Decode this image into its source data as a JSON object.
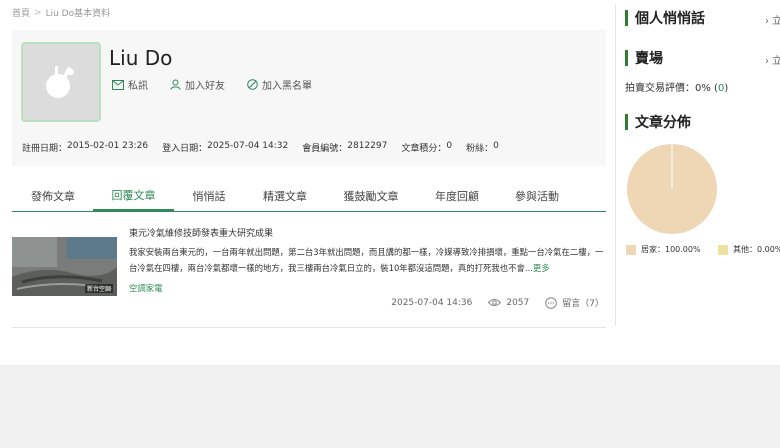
{
  "breadcrumb": {
    "home": "首頁",
    "sep": ">",
    "current": "Liu Do基本資料"
  },
  "profile": {
    "name": "Liu Do",
    "actions": {
      "message": "私訊",
      "add_friend": "加入好友",
      "blacklist": "加入黑名單"
    },
    "stats": [
      {
        "label": "註冊日期：",
        "value": "2015-02-01 23:26"
      },
      {
        "label": "登入日期：",
        "value": "2025-07-04 14:32"
      },
      {
        "label": "會員編號：",
        "value": "2812297"
      },
      {
        "label": "文章積分：",
        "value": "0"
      },
      {
        "label": "粉絲：",
        "value": "0"
      }
    ]
  },
  "tabs": [
    {
      "label": "發佈文章",
      "active": false
    },
    {
      "label": "回覆文章",
      "active": true
    },
    {
      "label": "悄悄話",
      "active": false
    },
    {
      "label": "精選文章",
      "active": false
    },
    {
      "label": "獲鼓勵文章",
      "active": false
    },
    {
      "label": "年度回顧",
      "active": false
    },
    {
      "label": "參與活動",
      "active": false
    }
  ],
  "article": {
    "title": "東元冷氣維修技師發表重大研究成果",
    "body": "我家安裝兩台東元的，一台兩年就出問題，第二台3年就出問題，而且講的都一樣，冷媒導致冷排損壞，重點一台冷氣在二樓，一台冷氣在四樓，兩台冷氣都壞一樣的地方，我三樓兩台冷氣日立的，裝10年都沒這問題，真的打死我也不會...",
    "more": "更多",
    "category": "空調家電",
    "thumb_caption": "新台空調",
    "datetime": "2025-07-04 14:36",
    "views": "2057",
    "comments": "留言（7）"
  },
  "sidebar": {
    "private_chat": {
      "title": "個人悄悄話",
      "more": "› 立"
    },
    "market": {
      "title": "賣場",
      "more": "› 立"
    },
    "rating_label": "拍賣交易評價：",
    "rating_value": "0%",
    "rating_count_open": " (",
    "rating_count": "0",
    "rating_count_close": ")",
    "distribution": {
      "title": "文章分佈"
    }
  },
  "chart_data": {
    "type": "pie",
    "categories": [
      "居家",
      "其他"
    ],
    "values": [
      100.0,
      0.0
    ],
    "labels": [
      "居家：100.00%",
      "其他：0.00%"
    ],
    "colors": [
      "#efd7b5",
      "#ede2a2"
    ]
  },
  "colors": {
    "accent": "#2e8b57",
    "sidebar_bar": "#2e7d32"
  }
}
